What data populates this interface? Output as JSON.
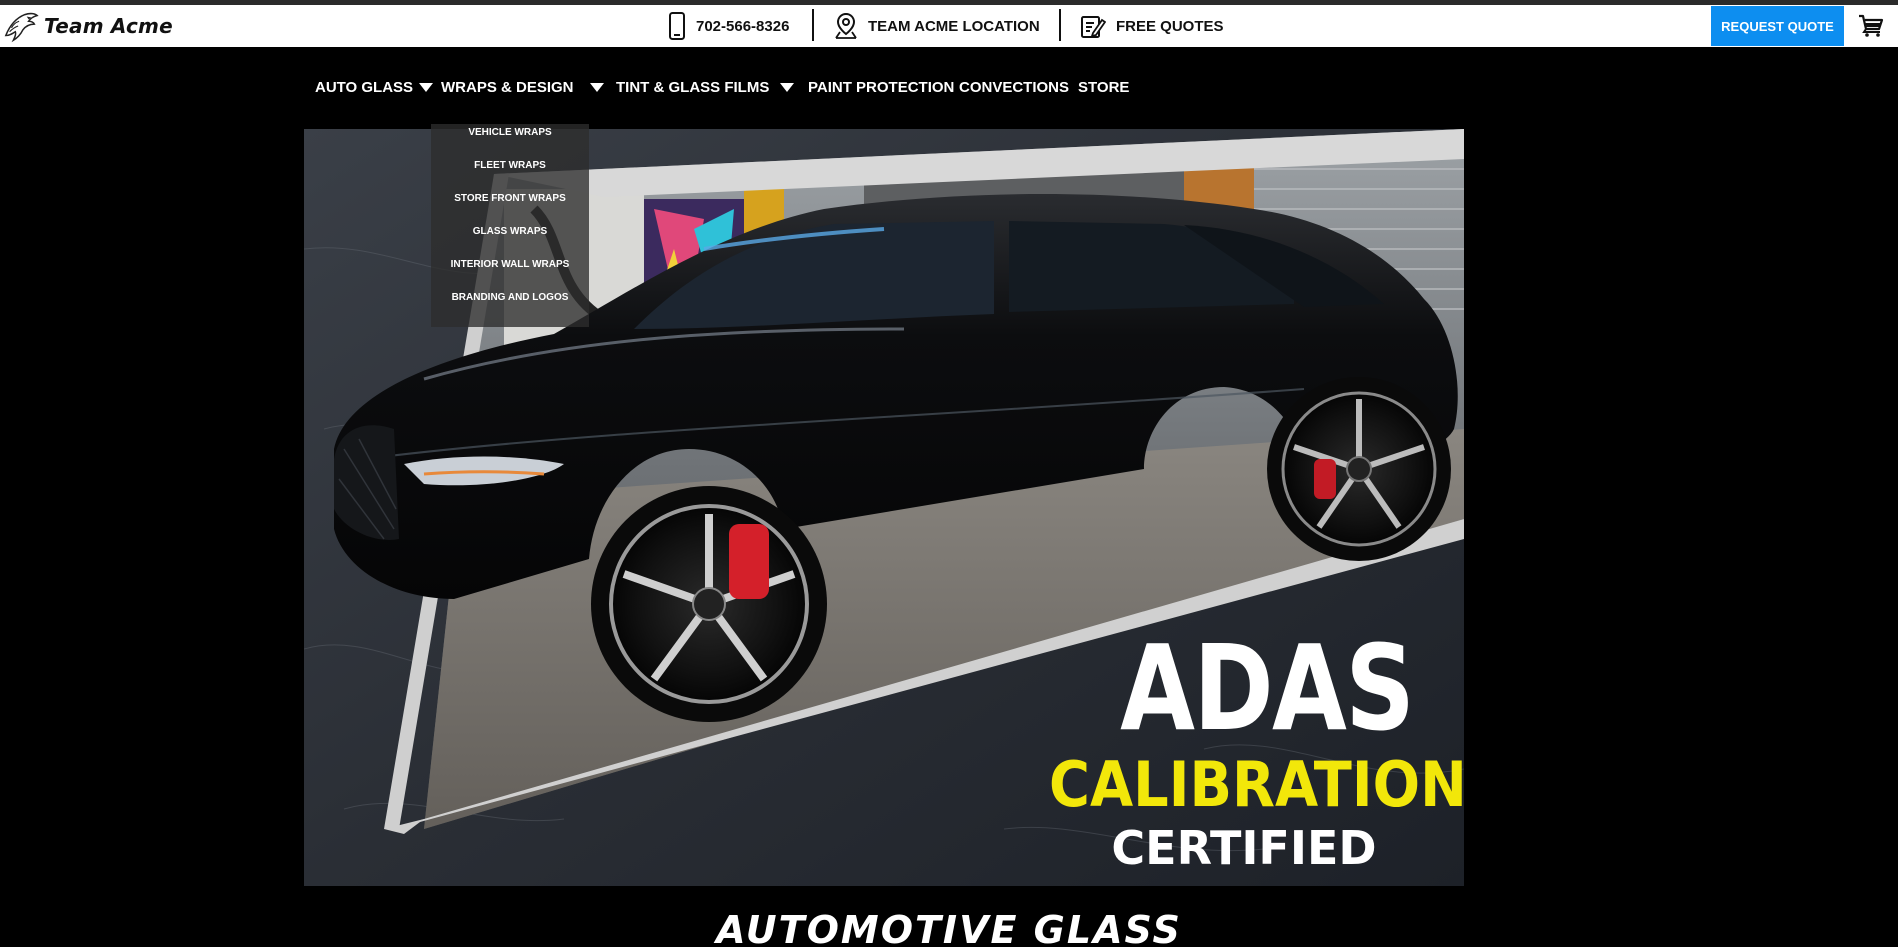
{
  "brand": {
    "name": "Team Acme"
  },
  "utility_bar": {
    "phone": "702-566-8326",
    "location": "TEAM ACME LOCATION",
    "quotes": "FREE QUOTES",
    "request_button": "REQUEST QUOTE"
  },
  "nav": {
    "items": [
      {
        "label": "AUTO GLASS",
        "has_dropdown": true
      },
      {
        "label": "WRAPS & DESIGN",
        "has_dropdown": true
      },
      {
        "label": "TINT & GLASS FILMS",
        "has_dropdown": true
      },
      {
        "label": "PAINT PROTECTION",
        "has_dropdown": false
      },
      {
        "label": "CONVECTIONS",
        "has_dropdown": false
      },
      {
        "label": "STORE",
        "has_dropdown": false
      }
    ]
  },
  "dropdown": {
    "open_under": "WRAPS & DESIGN",
    "items": [
      "VEHICLE WRAPS",
      "FLEET WRAPS",
      "STORE FRONT WRAPS",
      "GLASS WRAPS",
      "INTERIOR WALL WRAPS",
      "BRANDING AND LOGOS"
    ]
  },
  "hero": {
    "line1": "ADAS",
    "line2": "CALIBRATION",
    "line3": "CERTIFIED"
  },
  "section": {
    "heading": "AUTOMOTIVE GLASS"
  },
  "icons": {
    "phone": "phone-icon",
    "location": "map-pin-icon",
    "quotes": "clipboard-edit-icon",
    "cart": "cart-icon",
    "logo": "eagle-logo-icon"
  },
  "colors": {
    "accent_blue": "#0d8ef0",
    "highlight_yellow": "#f2e70a",
    "page_background": "#000000",
    "topbar_background": "#ffffff"
  }
}
